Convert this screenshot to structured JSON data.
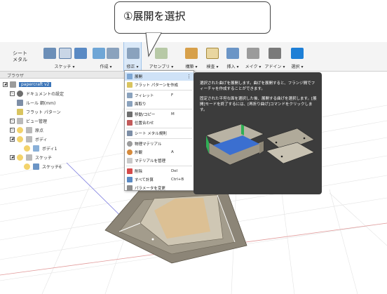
{
  "callout": {
    "text": "①展開を選択"
  },
  "ribbon": {
    "sheet_label_line1": "シート",
    "sheet_label_line2": "メタル",
    "tabs": [
      {
        "label": "スケッチ ▾"
      },
      {
        "label": "作成 ▾"
      },
      {
        "label": "修正 ▾"
      },
      {
        "label": "アセンブリ ▾"
      },
      {
        "label": "構築 ▾"
      },
      {
        "label": "検査 ▾"
      },
      {
        "label": "挿入 ▾"
      },
      {
        "label": "メイク ▾"
      },
      {
        "label": "アドイン ▾"
      },
      {
        "label": "選択 ▾"
      }
    ]
  },
  "browser": {
    "title": "ブラウザ",
    "root": "papercraft v2",
    "items": [
      {
        "label": "ドキュメントの設定"
      },
      {
        "label": "ルール 鋼(mm)"
      },
      {
        "label": "フラット パターン"
      },
      {
        "label": "ビュー管理"
      },
      {
        "label": "原点"
      },
      {
        "label": "ボディ"
      },
      {
        "label": "ボディ1"
      },
      {
        "label": "スケッチ"
      },
      {
        "label": "スケッチ6"
      }
    ]
  },
  "menu": {
    "items": [
      {
        "label": "展開",
        "key": ""
      },
      {
        "label": "フラット パターンを作成",
        "key": ""
      },
      {
        "label": "フィレット",
        "key": "F"
      },
      {
        "label": "面取り",
        "key": ""
      },
      {
        "label": "移動/コピー",
        "key": "M"
      },
      {
        "label": "位置合わせ",
        "key": ""
      },
      {
        "label": "シート メタル規則",
        "key": ""
      },
      {
        "label": "物理マテリアル",
        "key": ""
      },
      {
        "label": "外観",
        "key": "A"
      },
      {
        "label": "マテリアルを管理",
        "key": ""
      },
      {
        "label": "削除",
        "key": "Del"
      },
      {
        "label": "すべて計算",
        "key": "Ctrl+B"
      },
      {
        "label": "パラメータを変更",
        "key": ""
      }
    ]
  },
  "tooltip": {
    "para1": "選択された曲げを展開します。曲げを展開すると、フランジ間でフィーチャを作成することができます。",
    "para2": "固定された平坦な面を選択した後、展開する曲げを選択します。[展開]モードを終了するには、[再折り曲げ]コマンドをクリックします。"
  },
  "colors": {
    "accent": "#3a74b8",
    "ribbon_bg": "#f4f4f4",
    "tooltip_bg": "#3c3c3c",
    "highlight": "#cfe2f7",
    "model_gray": "#8c8577"
  }
}
